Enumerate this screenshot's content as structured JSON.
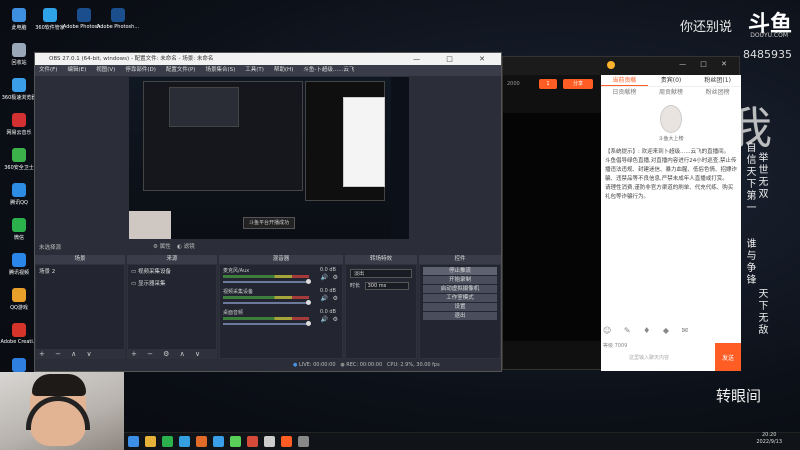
{
  "desktop_icons": [
    {
      "label": "此电脑",
      "icon": "computer-icon",
      "color": "#3f8fe0"
    },
    {
      "label": "回收站",
      "icon": "recycle-bin-icon",
      "color": "#9aa7b8"
    },
    {
      "label": "360极速浏览器",
      "icon": "browser-icon",
      "color": "#3a9ee8"
    },
    {
      "label": "网易云音乐",
      "icon": "music-icon",
      "color": "#d33131"
    },
    {
      "label": "360安全卫士",
      "icon": "shield-icon",
      "color": "#3bb34a"
    },
    {
      "label": "腾讯QQ",
      "icon": "qq-icon",
      "color": "#2d8ce3"
    },
    {
      "label": "微信",
      "icon": "wechat-icon",
      "color": "#2bb24c"
    },
    {
      "label": "腾讯视频",
      "icon": "video-icon",
      "color": "#2a86e8"
    },
    {
      "label": "QQ游戏",
      "icon": "game-icon",
      "color": "#e8a02a"
    },
    {
      "label": "Adobe Creati...",
      "icon": "adobe-icon",
      "color": "#d4342a"
    },
    {
      "label": "360驱动",
      "icon": "driver-icon",
      "color": "#2f7fe0"
    }
  ],
  "desktop_icons_row": [
    {
      "label": "360软件管家",
      "icon": "app-store-icon",
      "color": "#2fa3e8"
    },
    {
      "label": "Adobe Photosh...",
      "icon": "photoshop-icon",
      "color": "#1b4e8c"
    },
    {
      "label": "Adobe Photosh...",
      "icon": "photoshop-icon",
      "color": "#1b4e8c"
    }
  ],
  "brand": {
    "slogan": "你还别说",
    "logo": "斗鱼",
    "site": "DOUYU.COM",
    "room_id": "8485935"
  },
  "poem_left": "自信天下第一",
  "poem_right": "举世无双",
  "poem_col3": "谁与争锋",
  "poem_col4": "天下无敌",
  "corner_text": "转眼间",
  "big_char": "我",
  "obs": {
    "title": "OBS 27.0.1 (64-bit, windows) - 配置文件: 未命名 - 场景: 未命名",
    "menu": [
      "文件(F)",
      "编辑(E)",
      "视图(V)",
      "停靠部件(D)",
      "配置文件(P)",
      "场景集合(S)",
      "工具(T)",
      "帮助(H)",
      "斗鱼-卜超级......云飞"
    ],
    "toast": "斗鱼平台开播成功",
    "no_source": "未选择源",
    "props_label": "属性",
    "filters_label": "滤镜",
    "docks": {
      "scenes": {
        "title": "场景",
        "items": [
          "场景 2"
        ]
      },
      "sources": {
        "title": "来源",
        "items": [
          "视频采集设备",
          "显示器采集"
        ]
      },
      "mixer": {
        "title": "混音器",
        "channels": [
          {
            "name": "麦克风/Aux",
            "db": "0.0 dB"
          },
          {
            "name": "视频采集设备",
            "db": "0.0 dB"
          },
          {
            "name": "桌面音频",
            "db": "0.0 dB"
          }
        ]
      },
      "transitions": {
        "title": "转场特效",
        "type": "淡出",
        "duration_label": "时长",
        "duration": "300 ms"
      },
      "controls": {
        "title": "控件",
        "buttons": [
          "停止推流",
          "开始录制",
          "启动虚拟摄像机",
          "工作室模式",
          "设置",
          "退出"
        ]
      }
    },
    "status": {
      "live": "LIVE: 00:00:00",
      "rec": "REC: 00:00:00",
      "cpu": "CPU: 2.9%, 30.00 fps"
    }
  },
  "douyu_panel": {
    "tabs": [
      "当前贡献",
      "贵宾(0)",
      "粉丝团(1)"
    ],
    "subtabs": [
      "日贡献榜",
      "周贡献榜",
      "粉丝团榜"
    ],
    "host_name": "斗鱼大上榜",
    "chat": [
      "【系统提示】: 欢迎来到卜超级......云飞的直播间。",
      "斗鱼倡导绿色直播,对直播内容进行24小时巡查,禁止传播违法违规、封建迷信、暴力血腥、低俗色情、招嫖诈骗、违禁品等不良信息,严禁未成年人直播或打赏。",
      "请理性消费,谨防非官方渠道的刷单、代充代练、购买礼包等诈骗行为。"
    ],
    "send": "发送",
    "input_placeholder": "这里输入聊天内容",
    "level_text": "等级 7009",
    "stats": [
      "2000",
      "1",
      "分享"
    ]
  },
  "clock": {
    "time": "20:20",
    "date": "2022/9/13"
  }
}
